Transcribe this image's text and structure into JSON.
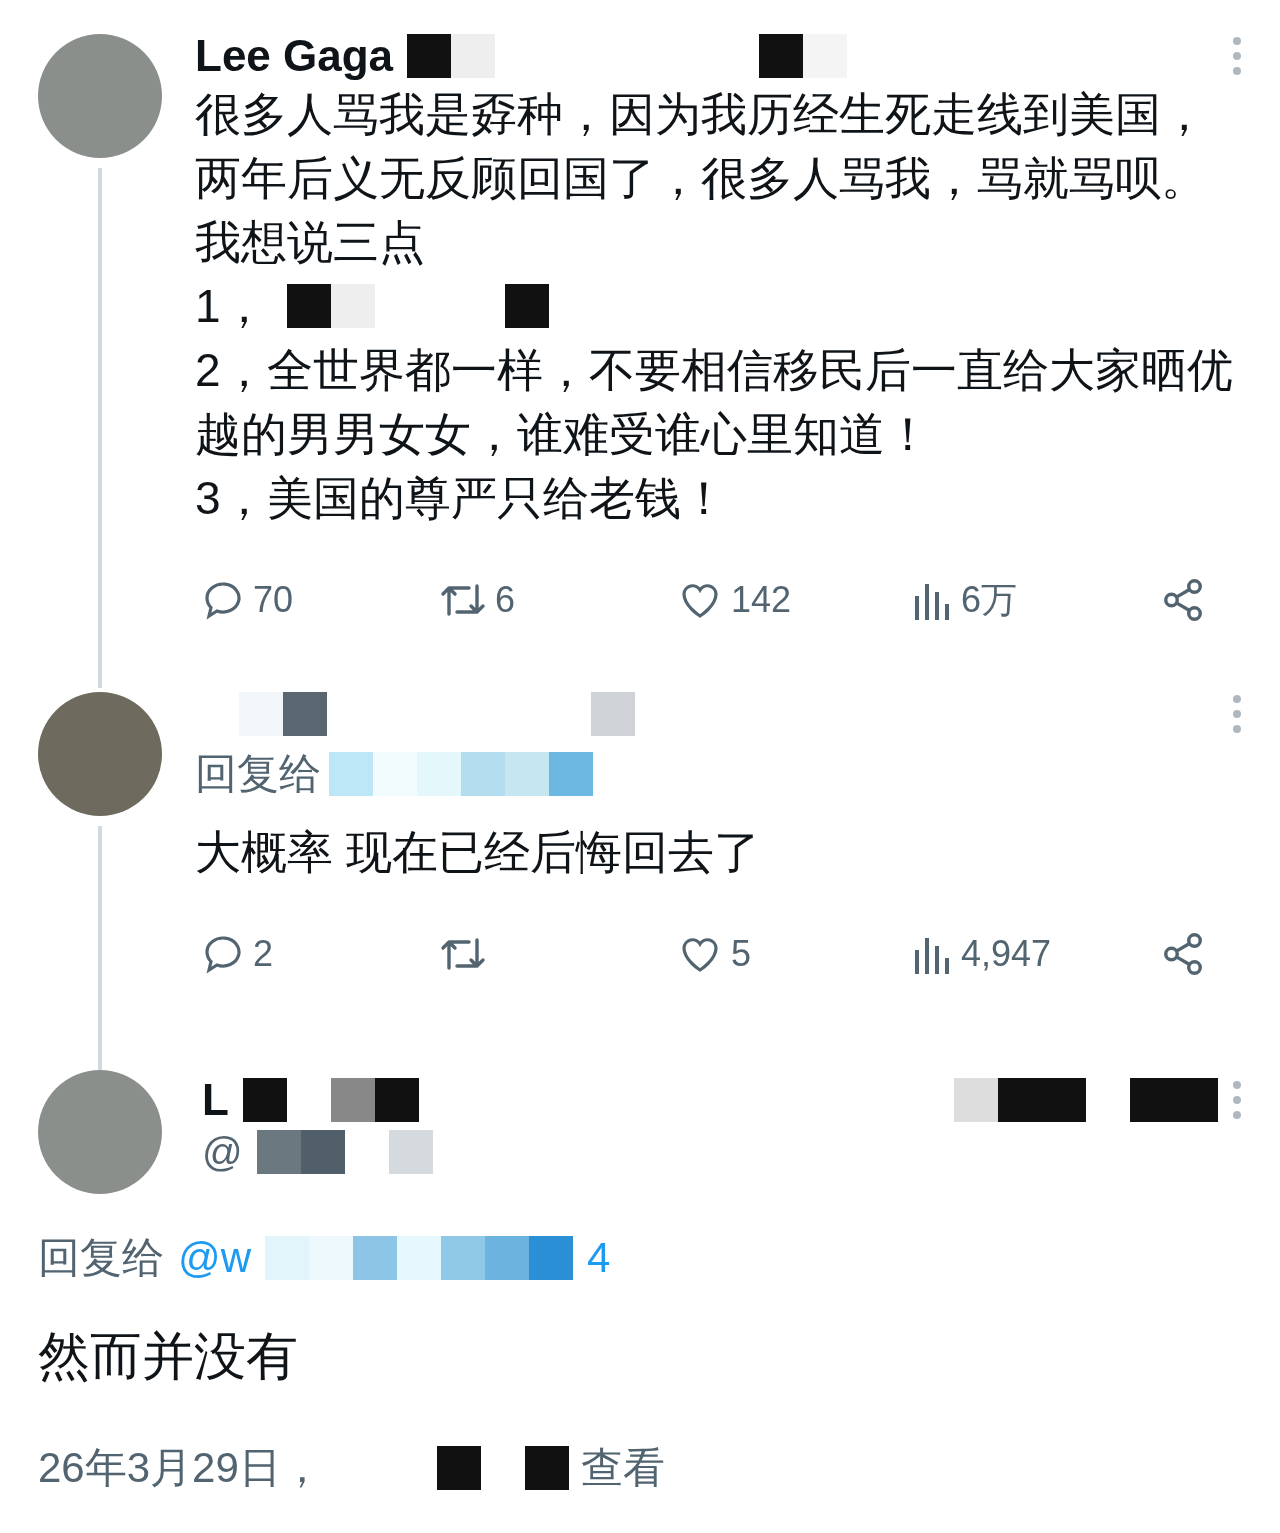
{
  "tweets": [
    {
      "name": "Lee Gaga",
      "paragraphs": [
        {
          "text": "很多人骂我是孬种，因为我历经生死走线到美国，两年后义无反顾回国了，很多人骂我，骂就骂呗。",
          "redacted": false
        },
        {
          "text": "我想说三点",
          "redacted": false
        },
        {
          "text": "1，",
          "redacted": true
        },
        {
          "text": "2，全世界都一样，不要相信移民后一直给大家晒优越的男男女女，谁难受谁心里知道！",
          "redacted": false
        },
        {
          "text": "3，美国的尊严只给老钱！",
          "redacted": false
        }
      ],
      "stats": {
        "replies": "70",
        "retweets": "6",
        "likes": "142",
        "views": "6万"
      }
    },
    {
      "reply_prefix": "回复给",
      "paragraphs": [
        {
          "text": "大概率 现在已经后悔回去了",
          "redacted": false
        }
      ],
      "stats": {
        "replies": "2",
        "likes": "5",
        "views": "4,947"
      }
    }
  ],
  "focused": {
    "name": "L",
    "handle": "@",
    "reply_prefix": "回复给",
    "reply_handle_start": "@w",
    "reply_handle_end": "4",
    "text": "然而并没有",
    "date": "26年3月29日，",
    "views_suffix": "查看"
  }
}
